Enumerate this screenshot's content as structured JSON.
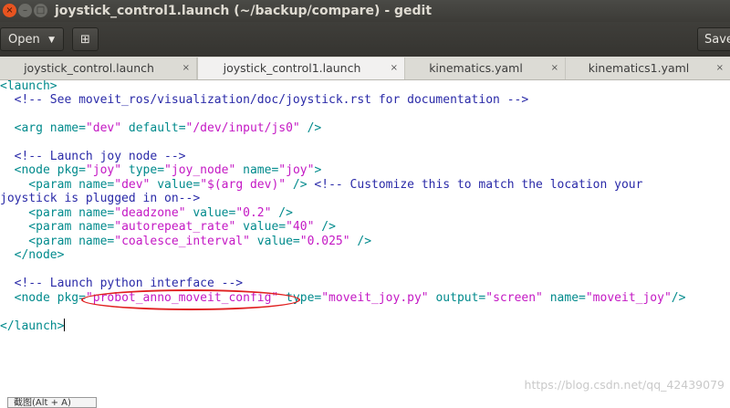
{
  "window": {
    "title": "joystick_control1.launch (~/backup/compare) - gedit",
    "buttons": {
      "close": "×",
      "minimize": "–",
      "maximize": "□"
    }
  },
  "toolbar": {
    "open_label": "Open",
    "open_caret": "▼",
    "new_glyph": "⊞",
    "save_label": "Save"
  },
  "tabs": [
    {
      "label": "joystick_control.launch",
      "close": "×"
    },
    {
      "label": "joystick_control1.launch",
      "close": "×"
    },
    {
      "label": "kinematics.yaml",
      "close": "×"
    },
    {
      "label": "kinematics1.yaml",
      "close": "×"
    }
  ],
  "code": {
    "l1": {
      "t": "<launch>"
    },
    "l2": {
      "c": "  <!-- See moveit_ros/visualization/doc/joystick.rst for documentation -->"
    },
    "l3": {
      "a": "  <arg",
      "b": " name=",
      "c": "\"dev\"",
      "d": " default=",
      "e": "\"/dev/input/js0\"",
      "f": " />"
    },
    "l4": {
      "c": "  <!-- Launch joy node -->"
    },
    "l5": {
      "a": "  <node",
      "b": " pkg=",
      "c": "\"joy\"",
      "d": " type=",
      "e": "\"joy_node\"",
      "f": " name=",
      "g": "\"joy\"",
      "h": ">"
    },
    "l6": {
      "a": "    <param",
      "b": " name=",
      "c": "\"dev\"",
      "d": " value=",
      "e": "\"$(arg dev)\"",
      "f": " />",
      "g": " <!-- Customize this to match the location your"
    },
    "l7": {
      "c": "joystick is plugged in on-->"
    },
    "l8": {
      "a": "    <param",
      "b": " name=",
      "c": "\"deadzone\"",
      "d": " value=",
      "e": "\"0.2\"",
      "f": " />"
    },
    "l9": {
      "a": "    <param",
      "b": " name=",
      "c": "\"autorepeat_rate\"",
      "d": " value=",
      "e": "\"40\"",
      "f": " />"
    },
    "l10": {
      "a": "    <param",
      "b": " name=",
      "c": "\"coalesce_interval\"",
      "d": " value=",
      "e": "\"0.025\"",
      "f": " />"
    },
    "l11": {
      "t": "  </node>"
    },
    "l12": {
      "c": "  <!-- Launch python interface -->"
    },
    "l13": {
      "a": "  <node",
      "b": " pkg=",
      "c": "\"probot_anno_moveit_config\"",
      "d": " type=",
      "e": "\"moveit_joy.py\"",
      "f": " output=",
      "g": "\"screen\"",
      "h": " name=",
      "i": "\"moveit_joy\"",
      "j": "/>"
    },
    "l14": {
      "t": "</launch>"
    }
  },
  "watermark": "https://blog.csdn.net/qq_42439079",
  "snip_label": "截图(Alt + A)",
  "colors": {
    "accent": "#e95420",
    "annotation": "#e02020",
    "tag": "#008a8c",
    "value": "#c418c4",
    "comment": "#2a2aa8"
  }
}
